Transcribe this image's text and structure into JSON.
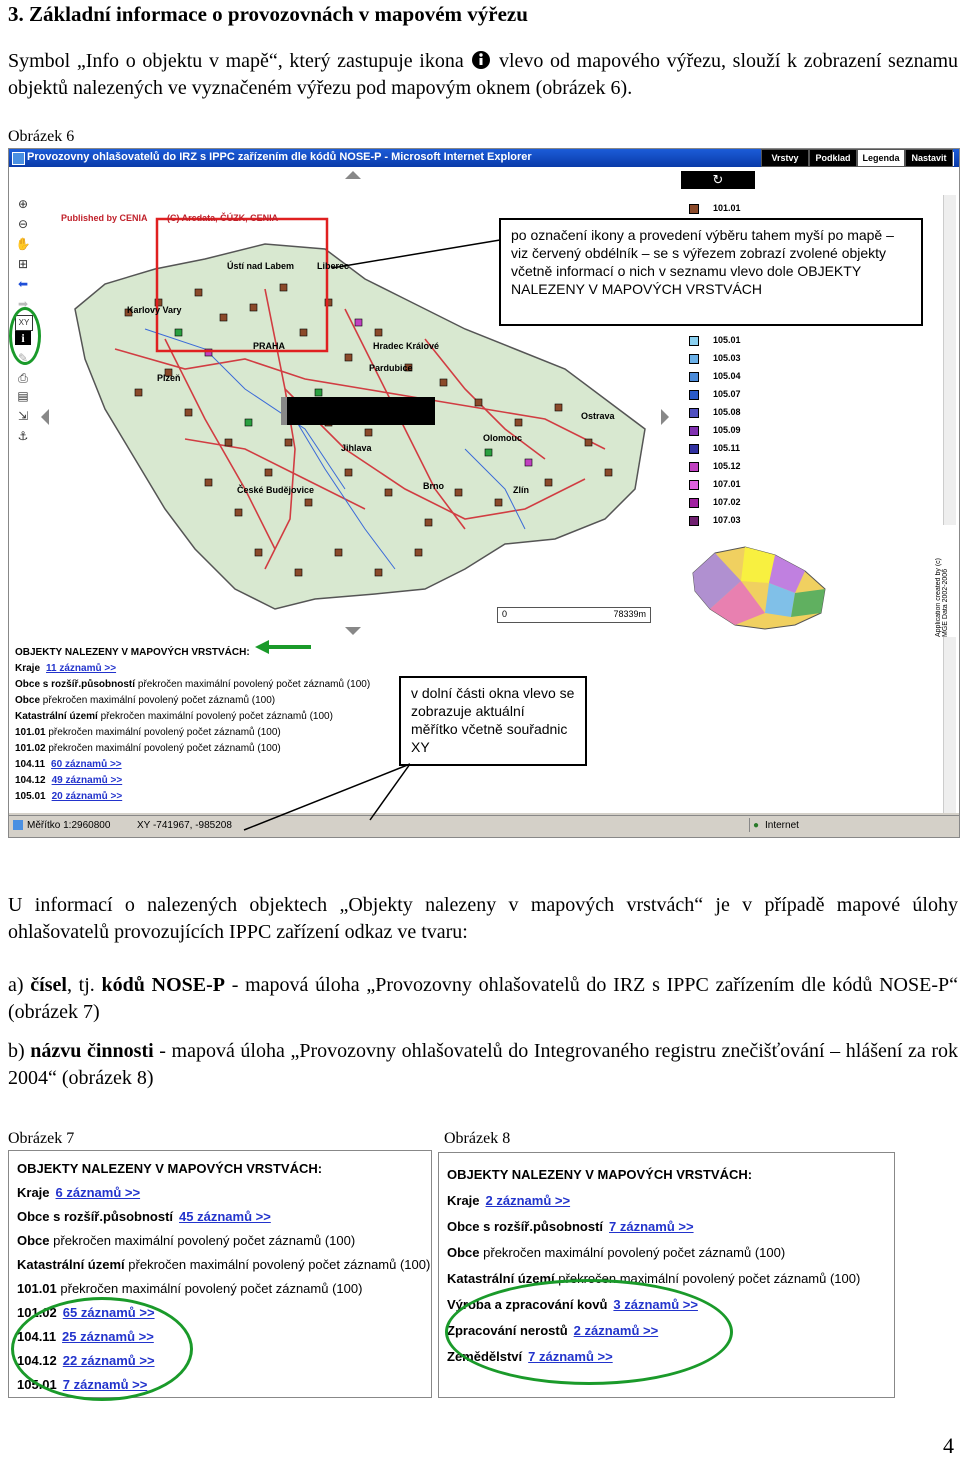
{
  "heading": "3. Základní informace o provozovnách v mapovém výřezu",
  "intro": {
    "part1": "Symbol „Info o objektu v mapě“, který zastupuje ikona",
    "part2": "vlevo od mapového výřezu, slouží k zobrazení seznamu objektů nalezených ve vyznačeném výřezu pod mapovým oknem (obrázek 6)."
  },
  "fig6": {
    "label": "Obrázek 6",
    "window_title": "Provozovny ohlašovatelů do IRZ s IPPC zařízením dle kódů NOSE-P - Microsoft Internet Explorer",
    "tabs": [
      "Vrstvy",
      "Podklad",
      "Legenda",
      "Nastavit"
    ],
    "published": "Published by CENIA",
    "copyright": "(C) Arcdata, ČÚZK, CENIA",
    "cities": [
      "Ústí nad Labem",
      "Liberec",
      "Karlovy Vary",
      "PRAHA",
      "Hradec Králové",
      "Pardubice",
      "Plzeň",
      "Ostrava",
      "Olomouc",
      "Jihlava",
      "České Budějovice",
      "Brno",
      "Zlín"
    ],
    "legend_codes": [
      "101.01",
      "105.01",
      "105.03",
      "105.04",
      "105.07",
      "105.08",
      "105.09",
      "105.11",
      "105.12",
      "107.01",
      "107.02",
      "107.03"
    ],
    "scale_start": "0",
    "scale_end": "78339m",
    "app_credit": "Application created by (c) MGE Data 2002-2006",
    "callout_top": "po označení ikony a provedení výběru tahem myší po mapě – viz červený obdélník – se s výřezem zobrazí zvolené objekty včetně informací o nich v seznamu vlevo dole OBJEKTY NALEZENY V MAPOVÝCH VRSTVÁCH",
    "callout_bottom": "v dolní části okna vlevo se zobrazuje aktuální měřítko včetně souřadnic XY",
    "results_title": "OBJEKTY NALEZENY V MAPOVÝCH VRSTVÁCH:",
    "results": [
      {
        "key": "Kraje",
        "text": "",
        "link": "11 záznamů >>"
      },
      {
        "key": "Obce s rozšíř.působností",
        "text": "překročen maximální povolený počet záznamů (100)",
        "link": ""
      },
      {
        "key": "Obce",
        "text": "překročen maximální povolený počet záznamů (100)",
        "link": ""
      },
      {
        "key": "Katastrální území",
        "text": "překročen maximální povolený počet záznamů (100)",
        "link": ""
      },
      {
        "key": "101.01",
        "text": "překročen maximální povolený počet záznamů (100)",
        "link": ""
      },
      {
        "key": "101.02",
        "text": "překročen maximální povolený počet záznamů (100)",
        "link": ""
      },
      {
        "key": "104.11",
        "text": "",
        "link": "60 záznamů >>"
      },
      {
        "key": "104.12",
        "text": "",
        "link": "49 záznamů >>"
      },
      {
        "key": "105.01",
        "text": "",
        "link": "20 záznamů >>"
      }
    ],
    "status_scale": "Měřítko 1:2960800",
    "status_xy": "XY -741967, -985208",
    "status_zone": "Internet"
  },
  "para2": "U informací o nalezených objektech „Objekty nalezeny v mapových vrstvách“ je v případě mapové úlohy ohlašovatelů provozujících IPPC zařízení odkaz ve tvaru:",
  "item_a": {
    "prefix": "a) ",
    "bold1": "čísel",
    "mid": ", tj. ",
    "bold2": "kódů NOSE-P",
    "rest": " - mapová úloha „Provozovny ohlašovatelů do IRZ s IPPC zařízením dle kódů NOSE-P“ (obrázek 7)"
  },
  "item_b": {
    "prefix": "b) ",
    "bold1": "názvu činnosti",
    "rest": " - mapová úloha „Provozovny ohlašovatelů do Integrovaného registru znečišťování – hlášení za rok 2004“ (obrázek 8)"
  },
  "fig7": {
    "label": "Obrázek 7",
    "title": "OBJEKTY NALEZENY V MAPOVÝCH VRSTVÁCH:",
    "rows": [
      {
        "key": "Kraje",
        "text": "",
        "link": "6 záznamů >>"
      },
      {
        "key": "Obce s rozšíř.působností",
        "text": "",
        "link": "45 záznamů >>"
      },
      {
        "key": "Obce",
        "text": "překročen maximální povolený počet záznamů (100)",
        "link": ""
      },
      {
        "key": "Katastrální území",
        "text": "překročen maximální povolený počet záznamů (100)",
        "link": ""
      },
      {
        "key": "101.01",
        "text": "překročen maximální povolený počet záznamů (100)",
        "link": ""
      },
      {
        "key": "101.02",
        "text": "",
        "link": "65 záznamů >>"
      },
      {
        "key": "104.11",
        "text": "",
        "link": "25 záznamů >>"
      },
      {
        "key": "104.12",
        "text": "",
        "link": "22 záznamů >>"
      },
      {
        "key": "105.01",
        "text": "",
        "link": "7 záznamů >>"
      }
    ]
  },
  "fig8": {
    "label": "Obrázek 8",
    "title": "OBJEKTY NALEZENY V MAPOVÝCH VRSTVÁCH:",
    "rows": [
      {
        "key": "Kraje",
        "text": "",
        "link": "2 záznamů >>"
      },
      {
        "key": "Obce s rozšíř.působností",
        "text": "",
        "link": "7 záznamů >>"
      },
      {
        "key": "Obce",
        "text": "překročen maximální povolený počet záznamů (100)",
        "link": ""
      },
      {
        "key": "Katastrální území",
        "text": "překročen maximální povolený počet záznamů (100)",
        "link": ""
      },
      {
        "key": "Výroba a zpracování kovů",
        "text": "",
        "link": "3 záznamů >>"
      },
      {
        "key": "Zpracování nerostů",
        "text": "",
        "link": "2 záznamů >>"
      },
      {
        "key": "Zemědělství",
        "text": "",
        "link": "7 záznamů >>"
      }
    ]
  },
  "page_number": "4",
  "colors": {
    "title_bar": "#0a3aa8",
    "link": "#2233cc",
    "selection_rect": "#e02020",
    "highlight_circle": "#1a9a2a",
    "arrow": "#1a9a2a"
  }
}
